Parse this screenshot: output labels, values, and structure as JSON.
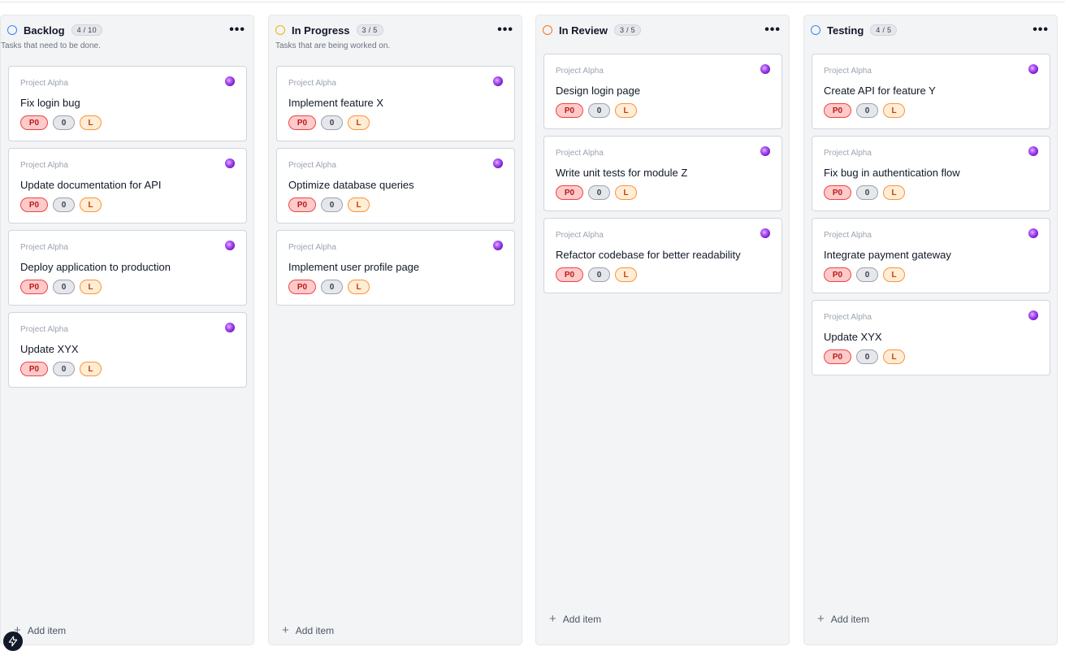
{
  "board": {
    "add_label": "Add item",
    "columns": [
      {
        "title": "Backlog",
        "count": "4 / 10",
        "description": "Tasks that need to be done.",
        "status_color": "#3b82f6",
        "cards": [
          {
            "project": "Project Alpha",
            "title": "Fix login bug",
            "priority": "P0",
            "points": "0",
            "label": "L"
          },
          {
            "project": "Project Alpha",
            "title": "Update documentation for API",
            "priority": "P0",
            "points": "0",
            "label": "L"
          },
          {
            "project": "Project Alpha",
            "title": "Deploy application to production",
            "priority": "P0",
            "points": "0",
            "label": "L"
          },
          {
            "project": "Project Alpha",
            "title": "Update XYX",
            "priority": "P0",
            "points": "0",
            "label": "L"
          }
        ]
      },
      {
        "title": "In Progress",
        "count": "3 / 5",
        "description": "Tasks that are being worked on.",
        "status_color": "#eab308",
        "cards": [
          {
            "project": "Project Alpha",
            "title": "Implement feature X",
            "priority": "P0",
            "points": "0",
            "label": "L"
          },
          {
            "project": "Project Alpha",
            "title": "Optimize database queries",
            "priority": "P0",
            "points": "0",
            "label": "L"
          },
          {
            "project": "Project Alpha",
            "title": "Implement user profile page",
            "priority": "P0",
            "points": "0",
            "label": "L"
          }
        ]
      },
      {
        "title": "In Review",
        "count": "3 / 5",
        "description": "",
        "status_color": "#f97316",
        "cards": [
          {
            "project": "Project Alpha",
            "title": "Design login page",
            "priority": "P0",
            "points": "0",
            "label": "L"
          },
          {
            "project": "Project Alpha",
            "title": "Write unit tests for module Z",
            "priority": "P0",
            "points": "0",
            "label": "L"
          },
          {
            "project": "Project Alpha",
            "title": "Refactor codebase for better readability",
            "priority": "P0",
            "points": "0",
            "label": "L"
          }
        ]
      },
      {
        "title": "Testing",
        "count": "4 / 5",
        "description": "",
        "status_color": "#3b82f6",
        "cards": [
          {
            "project": "Project Alpha",
            "title": "Create API for feature Y",
            "priority": "P0",
            "points": "0",
            "label": "L"
          },
          {
            "project": "Project Alpha",
            "title": "Fix bug in authentication flow",
            "priority": "P0",
            "points": "0",
            "label": "L"
          },
          {
            "project": "Project Alpha",
            "title": "Integrate payment gateway",
            "priority": "P0",
            "points": "0",
            "label": "L"
          },
          {
            "project": "Project Alpha",
            "title": "Update XYX",
            "priority": "P0",
            "points": "0",
            "label": "L"
          }
        ]
      }
    ]
  },
  "icons": {
    "menu": "more-horizontal-icon",
    "add": "plus-icon",
    "status": "status-circle-icon",
    "avatar": "avatar-icon",
    "fab": "lightning-icon"
  }
}
